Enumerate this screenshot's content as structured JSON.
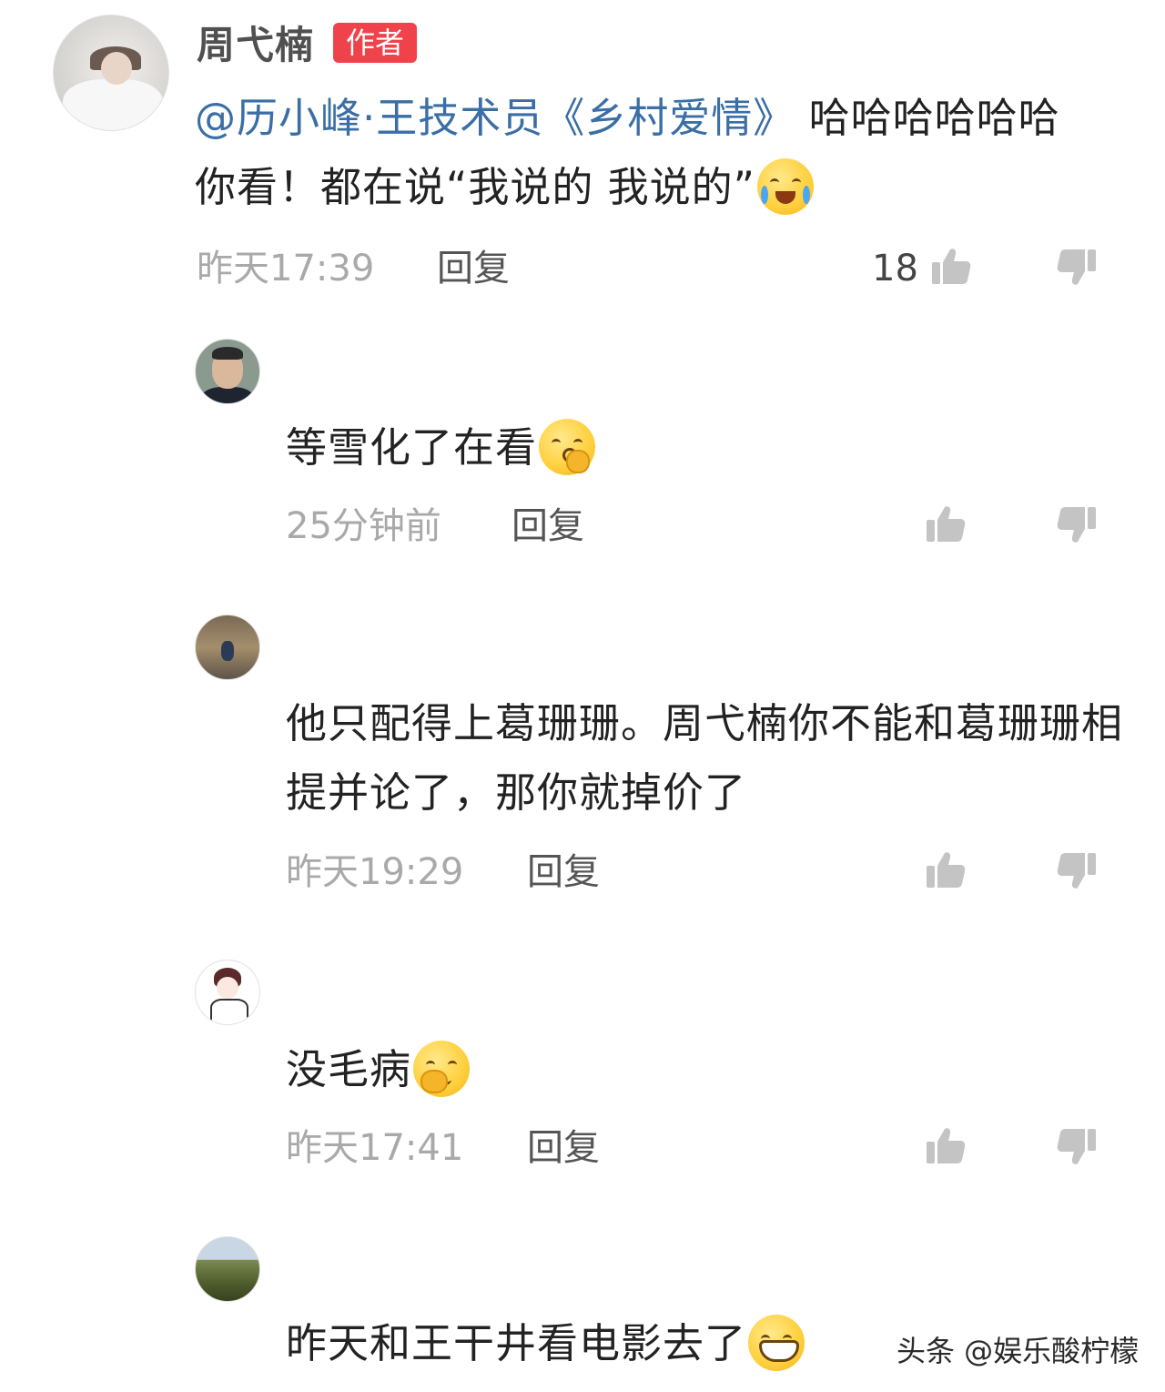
{
  "main_comment": {
    "username": "周弋楠",
    "badge": "作者",
    "mention": "@历小峰·王技术员《乡村爱情》",
    "text": " 哈哈哈哈哈哈 你看！都在说“我说的 我说的”",
    "emoji": "laugh-cry-emoji",
    "time": "昨天17:39",
    "reply_label": "回复",
    "like_count": "18"
  },
  "replies": [
    {
      "text": "等雪化了在看",
      "emoji": "shush-emoji",
      "time": "25分钟前",
      "reply_label": "回复"
    },
    {
      "text": "他只配得上葛珊珊。周弋楠你不能和葛珊珊相提并论了，那你就掉价了",
      "time": "昨天19:29",
      "reply_label": "回复"
    },
    {
      "text": "没毛病",
      "emoji": "snicker-emoji",
      "time": "昨天17:41",
      "reply_label": "回复"
    },
    {
      "text": "昨天和王干井看电影去了",
      "emoji": "grin-emoji"
    }
  ],
  "watermark": "头条 @娱乐酸柠檬",
  "colors": {
    "mention": "#3a6ea5",
    "badge": "#f0424a",
    "meta": "#a9a9a9",
    "icon": "#c4c4c4"
  }
}
